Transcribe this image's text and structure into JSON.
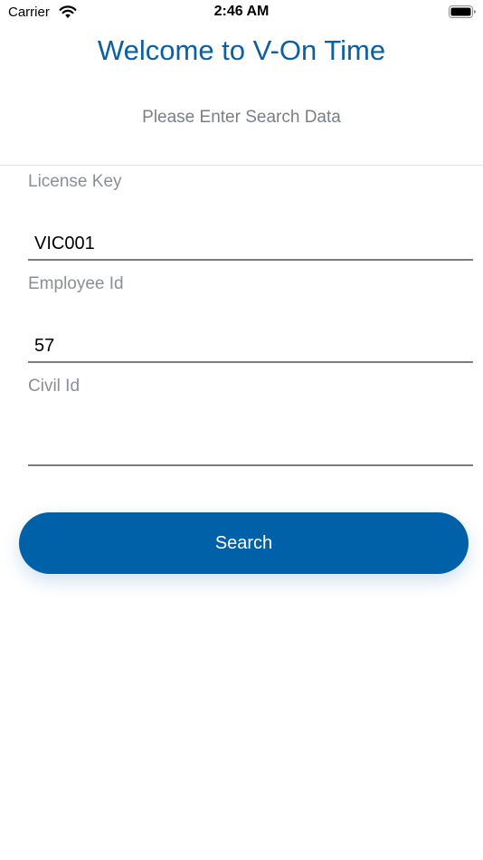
{
  "status_bar": {
    "carrier": "Carrier",
    "time": "2:46 AM",
    "icons": [
      "wifi-icon",
      "battery-icon"
    ]
  },
  "header": {
    "title": "Welcome to V-On Time",
    "subtitle": "Please Enter Search Data"
  },
  "form": {
    "license_key": {
      "label": "License Key",
      "value": "VIC001"
    },
    "employee_id": {
      "label": "Employee Id",
      "value": "57"
    },
    "civil_id": {
      "label": "Civil Id",
      "value": ""
    }
  },
  "actions": {
    "search_label": "Search"
  },
  "colors": {
    "accent": "#0060a8",
    "title": "#0b5fa5",
    "label": "#8a8f96"
  }
}
